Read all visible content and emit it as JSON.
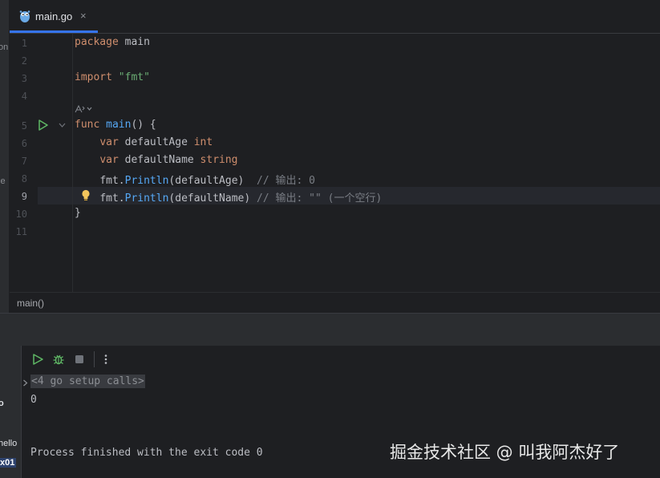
{
  "tab": {
    "label": "main.go",
    "close": "×",
    "icon": "go-gopher-icon"
  },
  "editor": {
    "line_numbers": [
      "1",
      "2",
      "3",
      "4",
      "5",
      "6",
      "7",
      "8",
      "9",
      "10",
      "11"
    ],
    "current_line": "9",
    "lines": {
      "l1_kw": "package",
      "l1_rest": " main",
      "l3_kw": "import",
      "l3_str": "\"fmt\"",
      "l5_kw": "func",
      "l5_fn": "main",
      "l5_rest": "() {",
      "l6_kw": "var",
      "l6_name": " defaultAge ",
      "l6_type": "int",
      "l7_kw": "var",
      "l7_name": " defaultName ",
      "l7_type": "string",
      "l8_pkg": "fmt.",
      "l8_call": "Println",
      "l8_args": "(defaultAge)",
      "l8_comment": "  // 输出: 0",
      "l9_pkg": "fmt.",
      "l9_call": "Println",
      "l9_args": "(defaultName)",
      "l9_comment": " // 输出: \"\" (一个空行)",
      "l10": "}"
    }
  },
  "breadcrumb": {
    "label": "main()"
  },
  "left_strip": {
    "frag1": "on",
    "frag2": "le"
  },
  "run": {
    "left_frags": [
      "o",
      "hello",
      "x01"
    ],
    "setup_calls": "<4 go setup calls>",
    "output_value": "0",
    "exit_message": "Process finished with the exit code 0"
  },
  "watermark": "掘金技术社区 @ 叫我阿杰好了",
  "colors": {
    "accent": "#3574f0",
    "keyword": "#cf8e6d",
    "function": "#56a8f5",
    "string": "#6aab73",
    "run_green": "#5fb865"
  }
}
